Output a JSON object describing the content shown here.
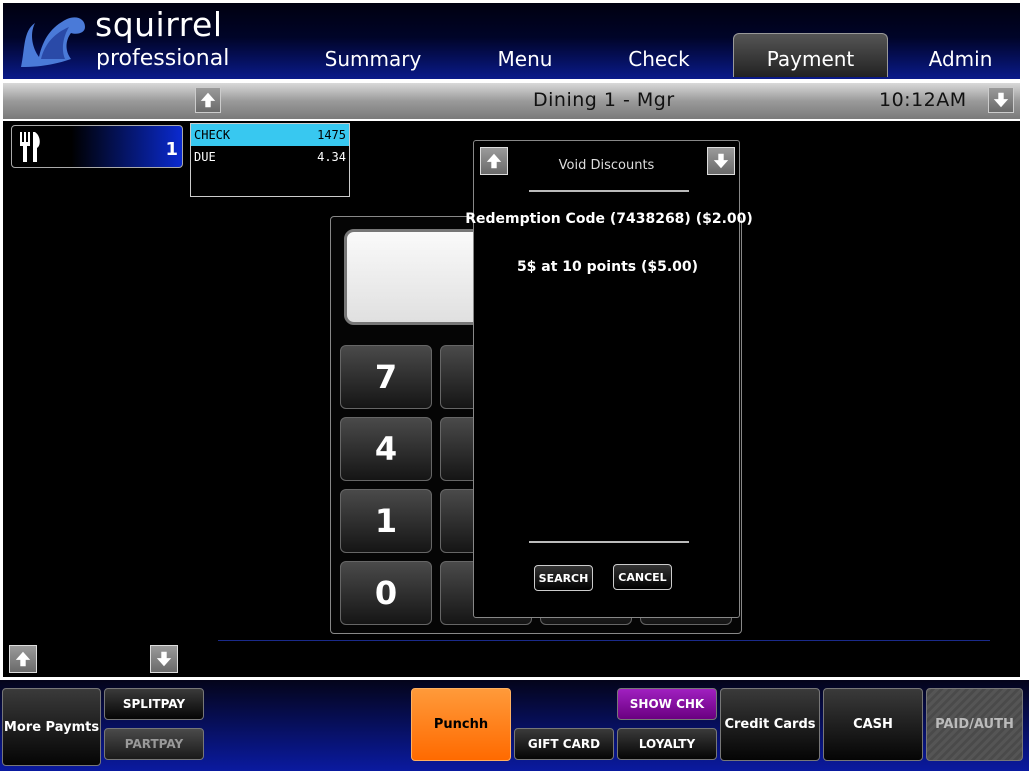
{
  "app": {
    "brand_title": "squirrel",
    "brand_subtitle": "professional"
  },
  "nav": {
    "tabs": [
      {
        "label": "Summary",
        "active": false
      },
      {
        "label": "Menu",
        "active": false
      },
      {
        "label": "Check",
        "active": false
      },
      {
        "label": "Payment",
        "active": true
      },
      {
        "label": "Admin",
        "active": false
      }
    ]
  },
  "subbar": {
    "title": "Dining 1 - Mgr",
    "time": "10:12AM"
  },
  "seat": {
    "number": "1",
    "icon": "fork-knife-icon"
  },
  "check": {
    "check_label": "CHECK",
    "check_number": "1475",
    "due_label": "DUE",
    "due_amount": "4.34"
  },
  "keypad": {
    "display_value": "",
    "keys": [
      "7",
      "4",
      "1",
      "0"
    ]
  },
  "dialog": {
    "title": "Void Discounts",
    "items": [
      "Redemption Code (7438268) ($2.00)",
      "5$ at 10 points ($5.00)"
    ],
    "search_label": "SEARCH",
    "cancel_label": "CANCEL"
  },
  "footer": {
    "more_payments": "More Paymts",
    "splitpay": "SPLITPAY",
    "partpay": "PARTPAY",
    "punchh": "Punchh",
    "gift_card": "GIFT CARD",
    "show_chk": "SHOW CHK",
    "loyalty": "LOYALTY",
    "credit_cards": "Credit Cards",
    "cash": "CASH",
    "paid_auth": "PAID/AUTH"
  },
  "colors": {
    "accent_blue": "#0a2ad0",
    "highlight_cyan": "#38c8f0",
    "punchh_orange": "#ff7a10",
    "show_chk_purple": "#8a10a0"
  }
}
